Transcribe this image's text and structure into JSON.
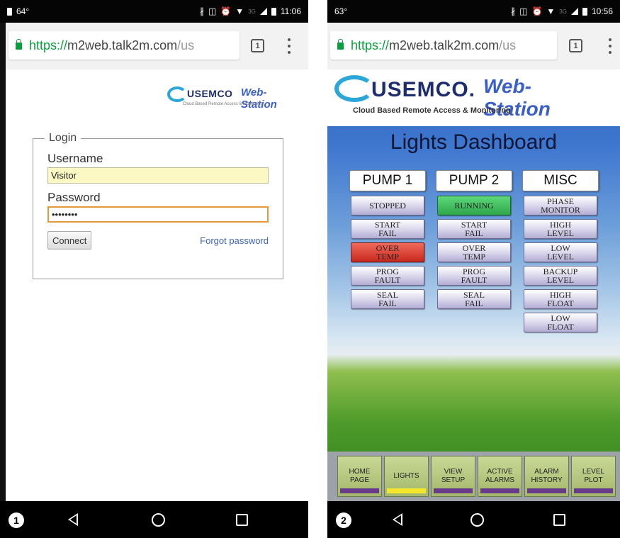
{
  "phone1": {
    "status": {
      "left": "64°",
      "time": "11:06",
      "net": "3G"
    },
    "url": {
      "green": "https://",
      "host": "m2web.talk2m.com",
      "rest": "/us"
    },
    "tabs_count": "1",
    "brand": {
      "name": "USEMCO",
      "ws": "Web-Station",
      "tagline": "Cloud Based Remote Access & Monitoring"
    },
    "login": {
      "legend": "Login",
      "username_label": "Username",
      "username_value": "Visitor",
      "password_label": "Password",
      "password_value": "••••••••",
      "connect": "Connect",
      "forgot": "Forgot password"
    },
    "badge": "1"
  },
  "phone2": {
    "status": {
      "left": "63°",
      "time": "10:56",
      "net": "3G"
    },
    "url": {
      "green": "https://",
      "host": "m2web.talk2m.com",
      "rest": "/us"
    },
    "tabs_count": "1",
    "brand": {
      "name": "USEMCO.",
      "ws": "Web-Station",
      "tagline": "Cloud Based Remote Access & Monitoring"
    },
    "title": "Lights Dashboard",
    "columns": [
      {
        "head": "PUMP 1",
        "items": [
          {
            "label": "STOPPED",
            "state": "normal"
          },
          {
            "label": "START\nFAIL",
            "state": "normal"
          },
          {
            "label": "OVER\nTEMP",
            "state": "alarm"
          },
          {
            "label": "PROG\nFAULT",
            "state": "normal"
          },
          {
            "label": "SEAL\nFAIL",
            "state": "normal"
          }
        ]
      },
      {
        "head": "PUMP 2",
        "items": [
          {
            "label": "RUNNING",
            "state": "running"
          },
          {
            "label": "START\nFAIL",
            "state": "normal"
          },
          {
            "label": "OVER\nTEMP",
            "state": "normal"
          },
          {
            "label": "PROG\nFAULT",
            "state": "normal"
          },
          {
            "label": "SEAL\nFAIL",
            "state": "normal"
          }
        ]
      },
      {
        "head": "MISC",
        "items": [
          {
            "label": "PHASE\nMONITOR",
            "state": "normal"
          },
          {
            "label": "HIGH\nLEVEL",
            "state": "normal"
          },
          {
            "label": "LOW\nLEVEL",
            "state": "normal"
          },
          {
            "label": "BACKUP\nLEVEL",
            "state": "normal"
          },
          {
            "label": "HIGH\nFLOAT",
            "state": "normal"
          },
          {
            "label": "LOW\nFLOAT",
            "state": "normal"
          }
        ]
      }
    ],
    "nav": [
      {
        "line1": "HOME",
        "line2": "PAGE",
        "active": false
      },
      {
        "line1": "LIGHTS",
        "line2": "",
        "active": true
      },
      {
        "line1": "VIEW",
        "line2": "SETUP",
        "active": false
      },
      {
        "line1": "ACTIVE",
        "line2": "ALARMS",
        "active": false
      },
      {
        "line1": "ALARM",
        "line2": "HISTORY",
        "active": false
      },
      {
        "line1": "LEVEL",
        "line2": "PLOT",
        "active": false
      }
    ],
    "badge": "2"
  },
  "colors": {
    "running": "#2ea64a",
    "alarm": "#c9291e",
    "active_indicator": "#f4e62a",
    "inactive_indicator": "#6a3a8a",
    "url_green": "#0a9e3f"
  }
}
